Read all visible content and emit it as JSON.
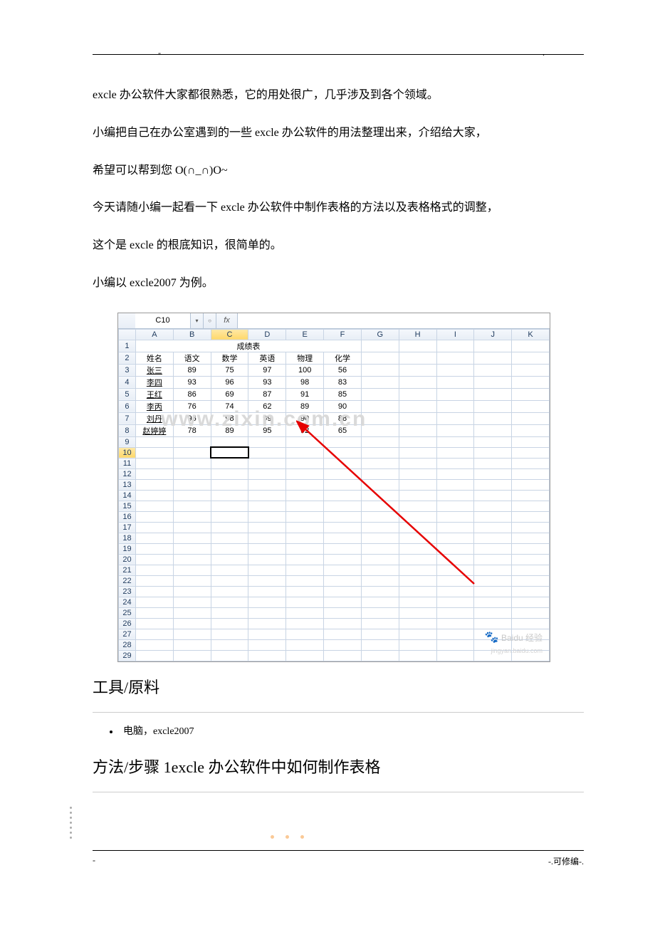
{
  "header": {
    "dash_left": "-",
    "dot_right": "."
  },
  "paragraphs": {
    "p1": "excle 办公软件大家都很熟悉，它的用处很广，几乎涉及到各个领域。",
    "p2a": "小编把自己在办公室遇到的一些 excle 办公软件的用法整理出来，介绍给大家，",
    "p2b": "希望可以帮到您 O(∩_∩)O~",
    "p3a": "今天请随小编一起看一下 excle 办公软件中制作表格的方法以及表格格式的调整，",
    "p3b": "这个是 excle 的根底知识，很简单的。",
    "p4": "小编以 excle2007 为例。"
  },
  "screenshot": {
    "namebox": "C10",
    "fx": "fx",
    "columns": [
      "A",
      "B",
      "C",
      "D",
      "E",
      "F",
      "G",
      "H",
      "I",
      "J",
      "K"
    ],
    "selected_col": "C",
    "selected_row": 10,
    "row_count": 29,
    "title_cell": "成绩表",
    "data_rows": [
      [
        "姓名",
        "语文",
        "数学",
        "英语",
        "物理",
        "化学"
      ],
      [
        "张三",
        "89",
        "75",
        "97",
        "100",
        "56"
      ],
      [
        "李四",
        "93",
        "96",
        "93",
        "98",
        "83"
      ],
      [
        "王红",
        "86",
        "69",
        "87",
        "91",
        "85"
      ],
      [
        "李丙",
        "76",
        "74",
        "62",
        "89",
        "90"
      ],
      [
        "刘丹",
        "96",
        "98",
        "99",
        "90",
        "88"
      ],
      [
        "赵婷婷",
        "78",
        "89",
        "95",
        "92",
        "65"
      ]
    ],
    "watermark_text": "www.zixin.com.cn",
    "baidu_text": "Baidu 经验",
    "baidu_sub": "jingyan.baidu.com"
  },
  "sections": {
    "tools_title": "工具/原料",
    "tools_item": "电脑，excle2007",
    "steps_title": "方法/步骤 1excle 办公软件中如何制作表格"
  },
  "footer": {
    "left": "-",
    "right": "-.可修编-."
  }
}
